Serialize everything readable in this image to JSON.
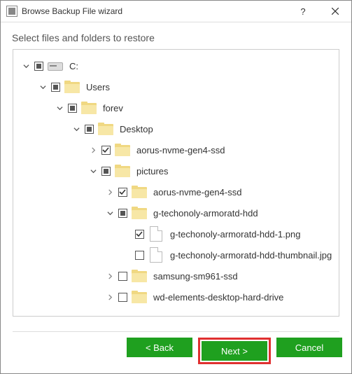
{
  "window": {
    "title": "Browse Backup File wizard",
    "help_tooltip": "Help",
    "close_tooltip": "Close"
  },
  "subheader": "Select files and folders to restore",
  "tree": {
    "n0": {
      "label": "C:",
      "state": "partial",
      "exp": "open",
      "icon": "drive",
      "indent": 0
    },
    "n1": {
      "label": "Users",
      "state": "partial",
      "exp": "open",
      "icon": "folder",
      "indent": 1
    },
    "n2": {
      "label": "forev",
      "state": "partial",
      "exp": "open",
      "icon": "folder",
      "indent": 2
    },
    "n3": {
      "label": "Desktop",
      "state": "partial",
      "exp": "open",
      "icon": "folder",
      "indent": 3
    },
    "n4": {
      "label": "aorus-nvme-gen4-ssd",
      "state": "checked",
      "exp": "closed",
      "icon": "folder",
      "indent": 4
    },
    "n5": {
      "label": "pictures",
      "state": "partial",
      "exp": "open",
      "icon": "folder",
      "indent": 4
    },
    "n6": {
      "label": "aorus-nvme-gen4-ssd",
      "state": "checked",
      "exp": "closed",
      "icon": "folder",
      "indent": 5
    },
    "n7": {
      "label": "g-techonoly-armoratd-hdd",
      "state": "partial",
      "exp": "open",
      "icon": "folder",
      "indent": 5
    },
    "n8": {
      "label": "g-techonoly-armoratd-hdd-1.png",
      "state": "checked",
      "exp": "none",
      "icon": "file",
      "indent": 6
    },
    "n9": {
      "label": "g-techonoly-armoratd-hdd-thumbnail.jpg",
      "state": "unchecked",
      "exp": "none",
      "icon": "file",
      "indent": 6
    },
    "n10": {
      "label": "samsung-sm961-ssd",
      "state": "unchecked",
      "exp": "closed",
      "icon": "folder",
      "indent": 5
    },
    "n11": {
      "label": "wd-elements-desktop-hard-drive",
      "state": "unchecked",
      "exp": "closed",
      "icon": "folder",
      "indent": 5
    }
  },
  "buttons": {
    "back": "< Back",
    "next": "Next >",
    "cancel": "Cancel"
  },
  "colors": {
    "accent": "#1fa01f",
    "highlight": "#e03030"
  }
}
